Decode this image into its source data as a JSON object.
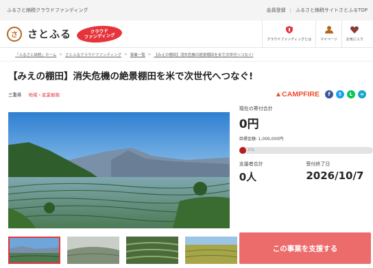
{
  "topbar": {
    "tagline": "ふるさと納税クラウドファンディング",
    "member_register": "会員登録",
    "site_top": "ふるさと納税サイトさとふるTOP"
  },
  "header": {
    "brand": "さとふる",
    "logo_mark": "さ",
    "badge_line1": "クラウド",
    "badge_line2": "ファンディング",
    "nav": [
      {
        "label": "クラウドファンディングとは",
        "icon": "shield-icon",
        "color": "#e6343c"
      },
      {
        "label": "マイページ",
        "icon": "user-icon",
        "color": "#b5651d"
      },
      {
        "label": "お気に入り",
        "icon": "heart-icon",
        "color": "#8b3a3a"
      }
    ]
  },
  "breadcrumb": [
    "「ふるさと納税」ホーム",
    "さとふるクラウドファンディング",
    "事業一覧",
    "【みえの棚田】消失危機の絶景棚田を米で次世代へつなぐ!"
  ],
  "project": {
    "title": "【みえの棚田】消失危機の絶景棚田を米で次世代へつなぐ!",
    "prefecture": "三重県",
    "category": "地域・産業振興",
    "platform": "CAMPFIRE"
  },
  "share": [
    {
      "name": "facebook-icon",
      "glyph": "f",
      "color": "#3b5998"
    },
    {
      "name": "twitter-icon",
      "glyph": "t",
      "color": "#1da1f2"
    },
    {
      "name": "line-icon",
      "glyph": "L",
      "color": "#06c755"
    },
    {
      "name": "link-icon",
      "glyph": "∞",
      "color": "#1aa5c9"
    }
  ],
  "stats": {
    "current_label": "現在の寄付合計",
    "current_value": "0円",
    "goal_text": "目標金額: 1,000,000円",
    "progress_fraction": 0.0,
    "progress_label": "0%",
    "supporters_label": "支援者合計",
    "supporters_value": "0人",
    "deadline_label": "受付終了日",
    "deadline_value": "2026/10/7"
  },
  "support_button": "この事業を支援する",
  "colors": {
    "accent": "#e6343c",
    "button": "#ec6b6b",
    "campfire": "#ee4d2d"
  }
}
